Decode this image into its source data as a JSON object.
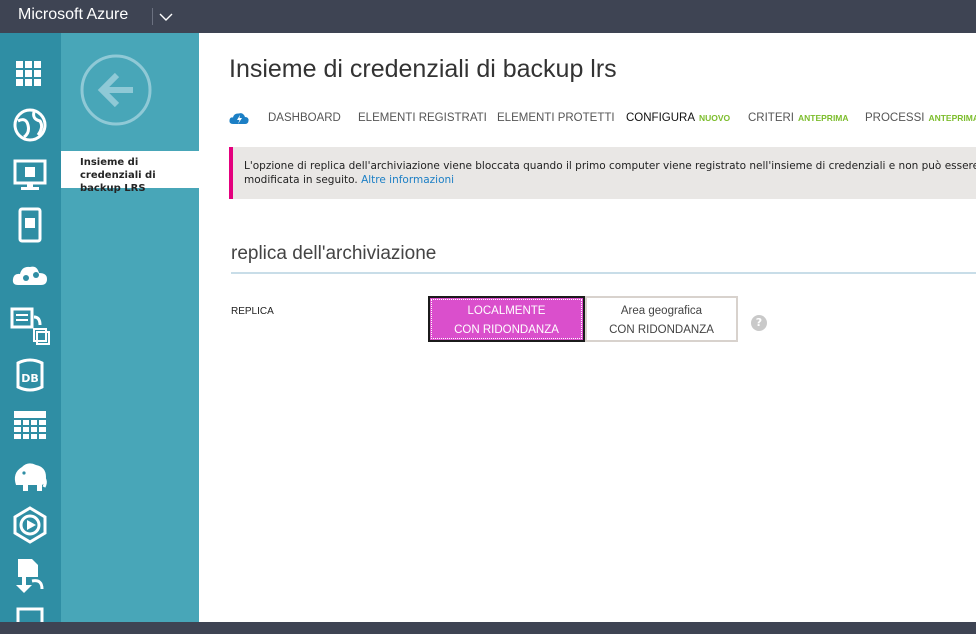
{
  "header": {
    "brand": "Microsoft Azure"
  },
  "leftnav": {
    "icons": [
      "grid-all-items-icon",
      "web-globe-icon",
      "virtual-machine-icon",
      "mobile-service-icon",
      "cloud-service-icon",
      "batch-service-icon",
      "sql-database-icon",
      "storage-table-icon",
      "hdinsight-elephant-icon",
      "media-service-icon",
      "service-bus-icon",
      "more-icon"
    ]
  },
  "subnav": {
    "item_label": "Insieme di credenziali di backup LRS"
  },
  "main": {
    "title": "Insieme di credenziali di backup lrs",
    "tabs": [
      {
        "label": "DASHBOARD",
        "badge": ""
      },
      {
        "label": "ELEMENTI REGISTRATI",
        "badge": ""
      },
      {
        "label": "ELEMENTI PROTETTI",
        "badge": ""
      },
      {
        "label": "CONFIGURA",
        "badge": "NUOVO"
      },
      {
        "label": "CRITERI",
        "badge": "ANTEPRIMA"
      },
      {
        "label": "PROCESSI",
        "badge": "ANTEPRIMA"
      }
    ],
    "notice": {
      "text": "L'opzione di replica dell'archiviazione viene bloccata quando il primo computer viene registrato nell'insieme di credenziali e non può essere modificata in seguito.",
      "link": "Altre informazioni"
    },
    "section_title": "replica dell'archiviazione",
    "replica_label": "REPLICA",
    "options": {
      "lrs_line1": "LOCALMENTE",
      "lrs_line2": "CON RIDONDANZA",
      "grs_line1": "Area geografica",
      "grs_line2": "CON RIDONDANZA"
    },
    "help_symbol": "?"
  },
  "colors": {
    "topbar": "#3e4453",
    "leftnav": "#2f8ea4",
    "subnav": "#48a6b8",
    "accent_magenta": "#da4fcc",
    "badge_green": "#7cbd2c",
    "link_blue": "#1c7fc5",
    "notice_bar": "#e4007e"
  }
}
